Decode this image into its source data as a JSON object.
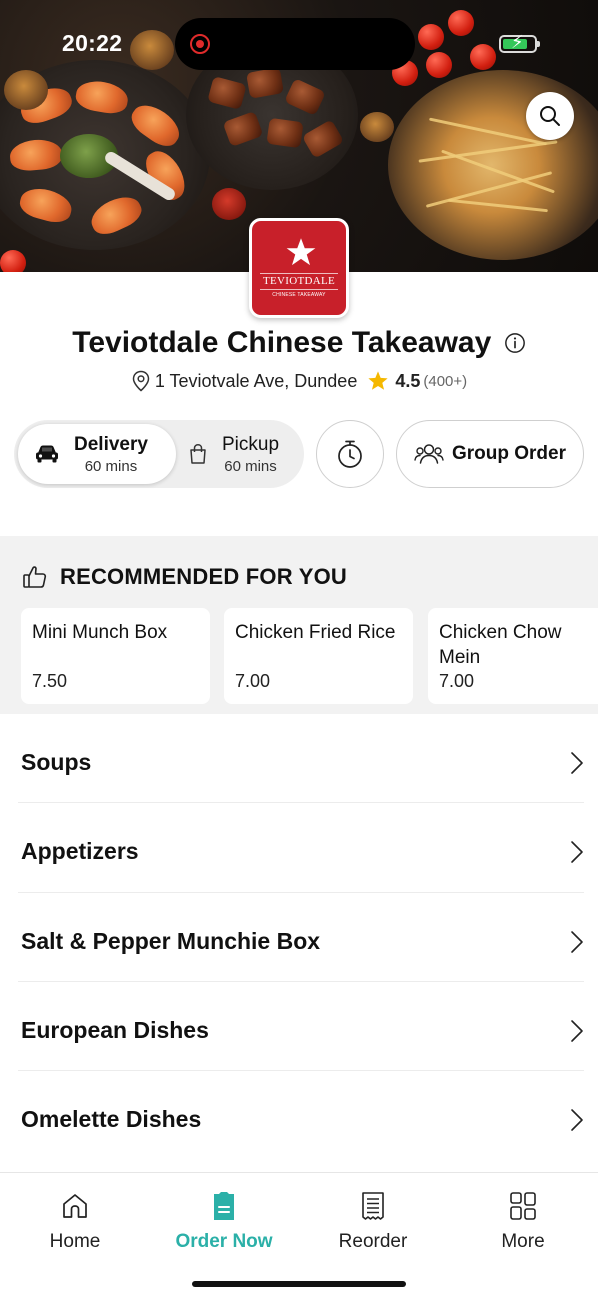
{
  "status_bar": {
    "time": "20:22"
  },
  "hero": {
    "search_icon": "search-icon"
  },
  "logo": {
    "brand": "TEVIOTDALE",
    "subtitle": "CHINESE TAKEAWAY"
  },
  "restaurant": {
    "name": "Teviotdale Chinese Takeaway",
    "address": "1 Teviotvale Ave, Dundee",
    "rating": "4.5",
    "rating_count": "(400+)"
  },
  "order_mode": {
    "delivery": {
      "label": "Delivery",
      "time": "60 mins",
      "selected": true
    },
    "pickup": {
      "label": "Pickup",
      "time": "60 mins",
      "selected": false
    }
  },
  "group_order": {
    "label": "Group Order"
  },
  "recommended": {
    "title": "RECOMMENDED FOR YOU",
    "items": [
      {
        "name": "Mini Munch Box",
        "price": "7.50"
      },
      {
        "name": "Chicken Fried Rice",
        "price": "7.00"
      },
      {
        "name": "Chicken Chow Mein",
        "price": "7.00"
      }
    ]
  },
  "categories": [
    {
      "label": "Soups"
    },
    {
      "label": "Appetizers"
    },
    {
      "label": "Salt & Pepper Munchie Box"
    },
    {
      "label": "European Dishes"
    },
    {
      "label": "Omelette Dishes"
    }
  ],
  "bottom_nav": {
    "items": [
      {
        "label": "Home",
        "icon": "home-icon"
      },
      {
        "label": "Order Now",
        "icon": "order-icon",
        "active": true
      },
      {
        "label": "Reorder",
        "icon": "receipt-icon"
      },
      {
        "label": "More",
        "icon": "grid-icon"
      }
    ]
  },
  "colors": {
    "accent": "#2bb0a8",
    "brand_red": "#c8202a",
    "star": "#f5b800"
  }
}
